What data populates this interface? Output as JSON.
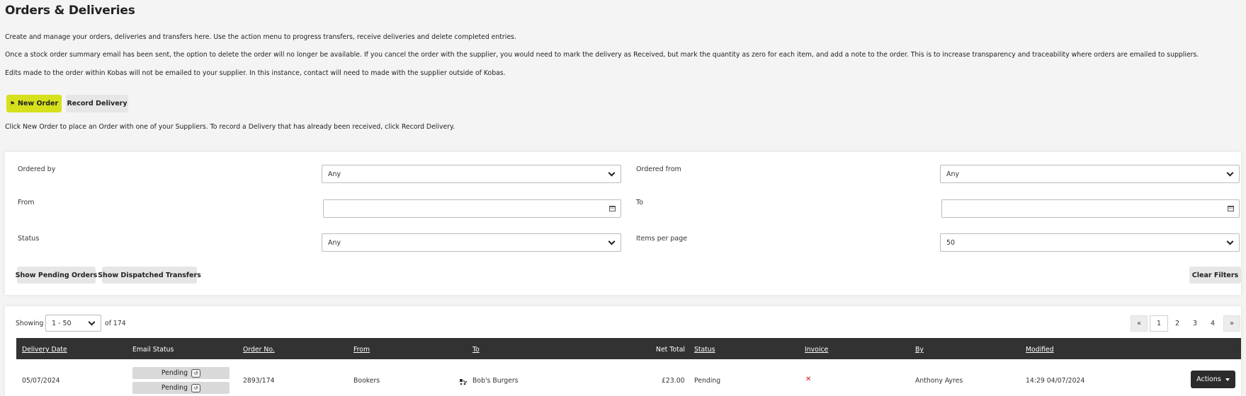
{
  "page": {
    "title": "Orders & Deliveries",
    "intro": [
      "Create and manage your orders, deliveries and transfers here. Use the action menu to progress transfers, receive deliveries and delete completed entries.",
      "Once a stock order summary email has been sent, the option to delete the order will no longer be available. If you cancel the order with the supplier, you would need to mark the delivery as Received, but mark the quantity as zero for each item, and add a note to the order. This is to increase transparency and traceability where orders are emailed to suppliers.",
      "Edits made to the order within Kobas will not be emailed to your supplier. In this instance, contact will need to made with the supplier outside of Kobas."
    ],
    "new_order_label": "New Order",
    "record_delivery_label": "Record Delivery",
    "help_text": "Click New Order to place an Order with one of your Suppliers. To record a Delivery that has already been received, click Record Delivery."
  },
  "filters": {
    "ordered_by_label": "Ordered by",
    "ordered_by_value": "Any",
    "ordered_from_label": "Ordered from",
    "ordered_from_value": "Any",
    "from_label": "From",
    "from_value": "",
    "to_label": "To",
    "to_value": "",
    "status_label": "Status",
    "status_value": "Any",
    "items_per_page_label": "Items per page",
    "items_per_page_value": "50",
    "show_pending_label": "Show Pending Orders",
    "show_dispatched_label": "Show Dispatched Transfers",
    "clear_label": "Clear Filters"
  },
  "results": {
    "showing_label": "Showing",
    "range_value": "1 - 50",
    "of_total": "of 174",
    "pagination": {
      "prev": "«",
      "pages": [
        "1",
        "2",
        "3",
        "4"
      ],
      "next": "»",
      "current": "1"
    }
  },
  "table": {
    "columns": [
      "Delivery Date",
      "Email Status",
      "Order No.",
      "From",
      "To",
      "Net Total",
      "Status",
      "Invoice",
      "By",
      "Modified"
    ],
    "rows": [
      {
        "delivery_date": "05/07/2024",
        "email_status": [
          "Pending",
          "Pending"
        ],
        "email_badge": "↺",
        "order_no": "2893/174",
        "from": "Bookers",
        "to": "Bob's Burgers",
        "net_total": "£23.00",
        "status": "Pending",
        "invoice": "✕",
        "by": "Anthony Ayres",
        "modified": "14:29 04/07/2024",
        "actions_label": "Actions"
      }
    ]
  },
  "colors": {
    "accent_yellow": "#d6e01c",
    "table_header": "#323232",
    "invoice_missing": "#d01b1b",
    "actions_button": "#2b2b2b"
  }
}
